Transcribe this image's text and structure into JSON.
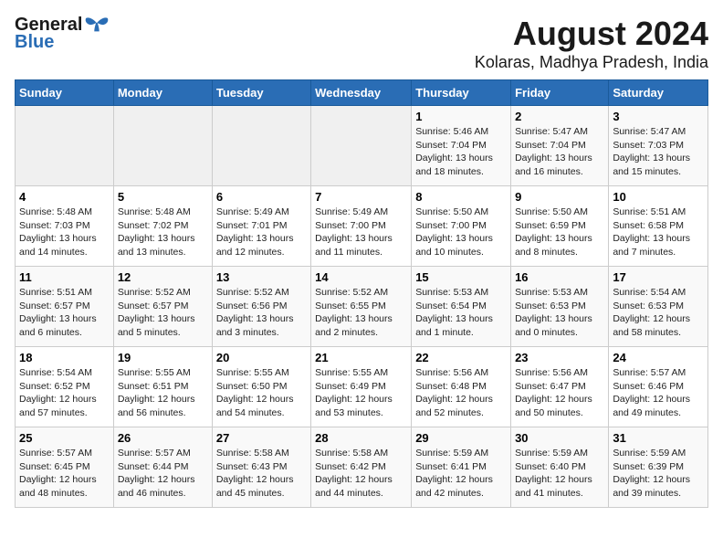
{
  "logo": {
    "general": "General",
    "blue": "Blue"
  },
  "title": "August 2024",
  "subtitle": "Kolaras, Madhya Pradesh, India",
  "days_of_week": [
    "Sunday",
    "Monday",
    "Tuesday",
    "Wednesday",
    "Thursday",
    "Friday",
    "Saturday"
  ],
  "weeks": [
    [
      {
        "day": "",
        "info": ""
      },
      {
        "day": "",
        "info": ""
      },
      {
        "day": "",
        "info": ""
      },
      {
        "day": "",
        "info": ""
      },
      {
        "day": "1",
        "info": "Sunrise: 5:46 AM\nSunset: 7:04 PM\nDaylight: 13 hours\nand 18 minutes."
      },
      {
        "day": "2",
        "info": "Sunrise: 5:47 AM\nSunset: 7:04 PM\nDaylight: 13 hours\nand 16 minutes."
      },
      {
        "day": "3",
        "info": "Sunrise: 5:47 AM\nSunset: 7:03 PM\nDaylight: 13 hours\nand 15 minutes."
      }
    ],
    [
      {
        "day": "4",
        "info": "Sunrise: 5:48 AM\nSunset: 7:03 PM\nDaylight: 13 hours\nand 14 minutes."
      },
      {
        "day": "5",
        "info": "Sunrise: 5:48 AM\nSunset: 7:02 PM\nDaylight: 13 hours\nand 13 minutes."
      },
      {
        "day": "6",
        "info": "Sunrise: 5:49 AM\nSunset: 7:01 PM\nDaylight: 13 hours\nand 12 minutes."
      },
      {
        "day": "7",
        "info": "Sunrise: 5:49 AM\nSunset: 7:00 PM\nDaylight: 13 hours\nand 11 minutes."
      },
      {
        "day": "8",
        "info": "Sunrise: 5:50 AM\nSunset: 7:00 PM\nDaylight: 13 hours\nand 10 minutes."
      },
      {
        "day": "9",
        "info": "Sunrise: 5:50 AM\nSunset: 6:59 PM\nDaylight: 13 hours\nand 8 minutes."
      },
      {
        "day": "10",
        "info": "Sunrise: 5:51 AM\nSunset: 6:58 PM\nDaylight: 13 hours\nand 7 minutes."
      }
    ],
    [
      {
        "day": "11",
        "info": "Sunrise: 5:51 AM\nSunset: 6:57 PM\nDaylight: 13 hours\nand 6 minutes."
      },
      {
        "day": "12",
        "info": "Sunrise: 5:52 AM\nSunset: 6:57 PM\nDaylight: 13 hours\nand 5 minutes."
      },
      {
        "day": "13",
        "info": "Sunrise: 5:52 AM\nSunset: 6:56 PM\nDaylight: 13 hours\nand 3 minutes."
      },
      {
        "day": "14",
        "info": "Sunrise: 5:52 AM\nSunset: 6:55 PM\nDaylight: 13 hours\nand 2 minutes."
      },
      {
        "day": "15",
        "info": "Sunrise: 5:53 AM\nSunset: 6:54 PM\nDaylight: 13 hours\nand 1 minute."
      },
      {
        "day": "16",
        "info": "Sunrise: 5:53 AM\nSunset: 6:53 PM\nDaylight: 13 hours\nand 0 minutes."
      },
      {
        "day": "17",
        "info": "Sunrise: 5:54 AM\nSunset: 6:53 PM\nDaylight: 12 hours\nand 58 minutes."
      }
    ],
    [
      {
        "day": "18",
        "info": "Sunrise: 5:54 AM\nSunset: 6:52 PM\nDaylight: 12 hours\nand 57 minutes."
      },
      {
        "day": "19",
        "info": "Sunrise: 5:55 AM\nSunset: 6:51 PM\nDaylight: 12 hours\nand 56 minutes."
      },
      {
        "day": "20",
        "info": "Sunrise: 5:55 AM\nSunset: 6:50 PM\nDaylight: 12 hours\nand 54 minutes."
      },
      {
        "day": "21",
        "info": "Sunrise: 5:55 AM\nSunset: 6:49 PM\nDaylight: 12 hours\nand 53 minutes."
      },
      {
        "day": "22",
        "info": "Sunrise: 5:56 AM\nSunset: 6:48 PM\nDaylight: 12 hours\nand 52 minutes."
      },
      {
        "day": "23",
        "info": "Sunrise: 5:56 AM\nSunset: 6:47 PM\nDaylight: 12 hours\nand 50 minutes."
      },
      {
        "day": "24",
        "info": "Sunrise: 5:57 AM\nSunset: 6:46 PM\nDaylight: 12 hours\nand 49 minutes."
      }
    ],
    [
      {
        "day": "25",
        "info": "Sunrise: 5:57 AM\nSunset: 6:45 PM\nDaylight: 12 hours\nand 48 minutes."
      },
      {
        "day": "26",
        "info": "Sunrise: 5:57 AM\nSunset: 6:44 PM\nDaylight: 12 hours\nand 46 minutes."
      },
      {
        "day": "27",
        "info": "Sunrise: 5:58 AM\nSunset: 6:43 PM\nDaylight: 12 hours\nand 45 minutes."
      },
      {
        "day": "28",
        "info": "Sunrise: 5:58 AM\nSunset: 6:42 PM\nDaylight: 12 hours\nand 44 minutes."
      },
      {
        "day": "29",
        "info": "Sunrise: 5:59 AM\nSunset: 6:41 PM\nDaylight: 12 hours\nand 42 minutes."
      },
      {
        "day": "30",
        "info": "Sunrise: 5:59 AM\nSunset: 6:40 PM\nDaylight: 12 hours\nand 41 minutes."
      },
      {
        "day": "31",
        "info": "Sunrise: 5:59 AM\nSunset: 6:39 PM\nDaylight: 12 hours\nand 39 minutes."
      }
    ]
  ]
}
